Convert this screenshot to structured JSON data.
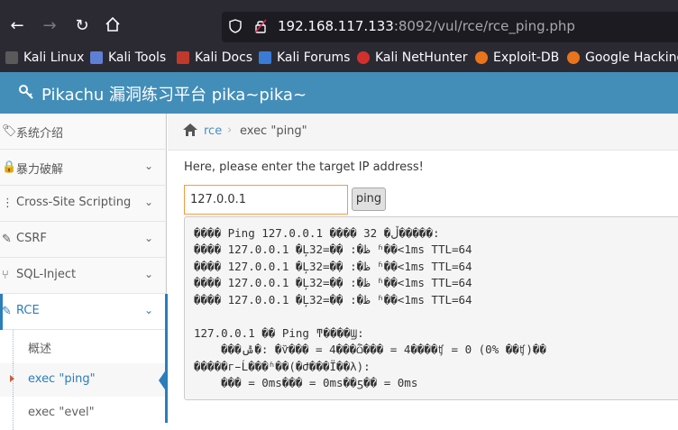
{
  "browser": {
    "url_host": "192.168.117.133",
    "url_rest": ":8092/vul/rce/rce_ping.php",
    "bookmarks": [
      {
        "label": "Kali Linux",
        "color": "#367bf0"
      },
      {
        "label": "Kali Tools",
        "color": "#e53b5c"
      },
      {
        "label": "Kali Docs",
        "color": "#c0392b"
      },
      {
        "label": "Kali Forums",
        "color": "#3a7bd5"
      },
      {
        "label": "Kali NetHunter",
        "color": "#d0312d"
      },
      {
        "label": "Exploit-DB",
        "color": "#e8741c"
      },
      {
        "label": "Google Hacking",
        "color": "#e8741c"
      }
    ]
  },
  "header": {
    "title": "Pikachu 漏洞练习平台 pika~pika~"
  },
  "sidebar": {
    "items": [
      {
        "label": "系统介绍"
      },
      {
        "label": "暴力破解"
      },
      {
        "label": "Cross-Site Scripting"
      },
      {
        "label": "CSRF"
      },
      {
        "label": "SQL-Inject"
      },
      {
        "label": "RCE"
      }
    ],
    "subitems": [
      {
        "label": "概述"
      },
      {
        "label": "exec \"ping\""
      },
      {
        "label": "exec \"evel\""
      }
    ]
  },
  "breadcrumbs": {
    "parent": "rce",
    "current": "exec \"ping\""
  },
  "form": {
    "instruction": "Here, please enter the target IP address!",
    "ip_value": "127.0.0.1",
    "button_label": "ping"
  },
  "output": {
    "lines": [
      "���� Ping 127.0.0.1 ���� 32 �ֽڵ�����:",
      "���� 127.0.0.1 �Ļظ�: �ֽ�=32 ʱ��<1ms TTL=64",
      "���� 127.0.0.1 �Ļظ�: �ֽ�=32 ʱ��<1ms TTL=64",
      "���� 127.0.0.1 �Ļظ�: �ֽ�=32 ʱ��<1ms TTL=64",
      "���� 127.0.0.1 �Ļظ�: �ֽ�=32 ʱ��<1ms TTL=64",
      "",
      "127.0.0.1 �� Ping ͳ����Ϣ:",
      "    ���ݰ�: �ѷ��� = 4���ѽ��� = 4����ʧ = 0 (0% ��ʧ)��",
      "�����г̵Ĺ���ʱ��(�Ժ���Ϊ��λ):",
      "    ��� = 0ms��� = 0ms��ƽ�� = 0ms"
    ]
  }
}
